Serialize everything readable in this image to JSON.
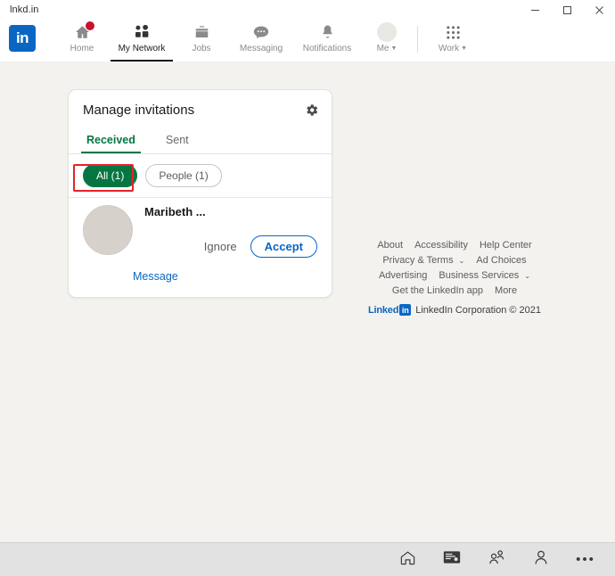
{
  "window": {
    "title": "lnkd.in",
    "minimize_label": "Minimize",
    "maximize_label": "Maximize",
    "close_label": "Close"
  },
  "nav": {
    "logo_text": "in",
    "items": [
      {
        "label": "Home",
        "icon": "home-icon",
        "active": false,
        "badge": true
      },
      {
        "label": "My Network",
        "icon": "network-icon",
        "active": true,
        "badge": false
      },
      {
        "label": "Jobs",
        "icon": "briefcase-icon",
        "active": false,
        "badge": false
      },
      {
        "label": "Messaging",
        "icon": "message-icon",
        "active": false,
        "badge": false
      },
      {
        "label": "Notifications",
        "icon": "bell-icon",
        "active": false,
        "badge": false
      }
    ],
    "me_label": "Me",
    "work_label": "Work",
    "caret": "▼"
  },
  "card": {
    "title": "Manage invitations",
    "gear_icon": "gear-icon",
    "tabs": [
      {
        "label": "Received",
        "active": true,
        "highlighted": true
      },
      {
        "label": "Sent",
        "active": false,
        "highlighted": false
      }
    ],
    "filters": [
      {
        "label": "All (1)",
        "selected": true
      },
      {
        "label": "People (1)",
        "selected": false
      }
    ],
    "invitation": {
      "name": "Maribeth ...",
      "ignore_label": "Ignore",
      "accept_label": "Accept",
      "message_label": "Message"
    }
  },
  "footer": {
    "rows": [
      [
        {
          "label": "About",
          "caret": false
        },
        {
          "label": "Accessibility",
          "caret": false
        },
        {
          "label": "Help Center",
          "caret": false
        }
      ],
      [
        {
          "label": "Privacy & Terms",
          "caret": true
        },
        {
          "label": "Ad Choices",
          "caret": false
        }
      ],
      [
        {
          "label": "Advertising",
          "caret": false
        },
        {
          "label": "Business Services",
          "caret": true
        }
      ],
      [
        {
          "label": "Get the LinkedIn app",
          "caret": false
        },
        {
          "label": "More",
          "caret": false
        }
      ]
    ],
    "caret_glyph": "⌄",
    "brand_word": "Linked",
    "brand_mark": "in",
    "copyright": "LinkedIn Corporation © 2021"
  },
  "taskbar": {
    "buttons": [
      {
        "icon": "home-icon",
        "name": "taskbar-home"
      },
      {
        "icon": "id-card-icon",
        "name": "taskbar-card"
      },
      {
        "icon": "people-icon",
        "name": "taskbar-people"
      },
      {
        "icon": "person-icon",
        "name": "taskbar-profile"
      },
      {
        "icon": "ellipsis-icon",
        "name": "taskbar-more"
      }
    ],
    "ellipsis": "•••"
  },
  "colors": {
    "linkedin_blue": "#0a66c2",
    "green": "#057642",
    "annotation_red": "#e82127",
    "badge_red": "#cb112d",
    "page_bg": "#f3f2ef"
  }
}
